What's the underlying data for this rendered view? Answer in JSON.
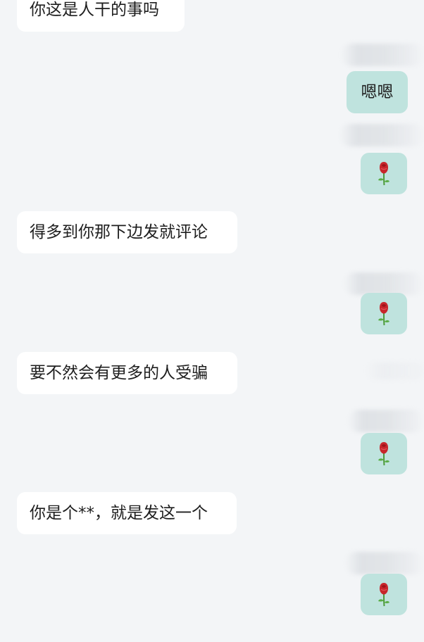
{
  "messages": [
    {
      "side": "in",
      "text": "你这是人干的事吗"
    },
    {
      "side": "out",
      "text": "嗯嗯"
    },
    {
      "side": "out",
      "icon": "rose-emoji"
    },
    {
      "side": "in",
      "text": "得多到你那下边发就评论"
    },
    {
      "side": "out",
      "icon": "rose-emoji"
    },
    {
      "side": "in",
      "text": "要不然会有更多的人受骗"
    },
    {
      "side": "out",
      "icon": "rose-emoji"
    },
    {
      "side": "in",
      "text": "你是个**，就是发这一个"
    },
    {
      "side": "out",
      "icon": "rose-emoji"
    }
  ],
  "colors": {
    "background": "#f3f5f7",
    "incoming_bubble": "#ffffff",
    "outgoing_bubble": "#bfe3de",
    "text": "#1e1e1e"
  }
}
